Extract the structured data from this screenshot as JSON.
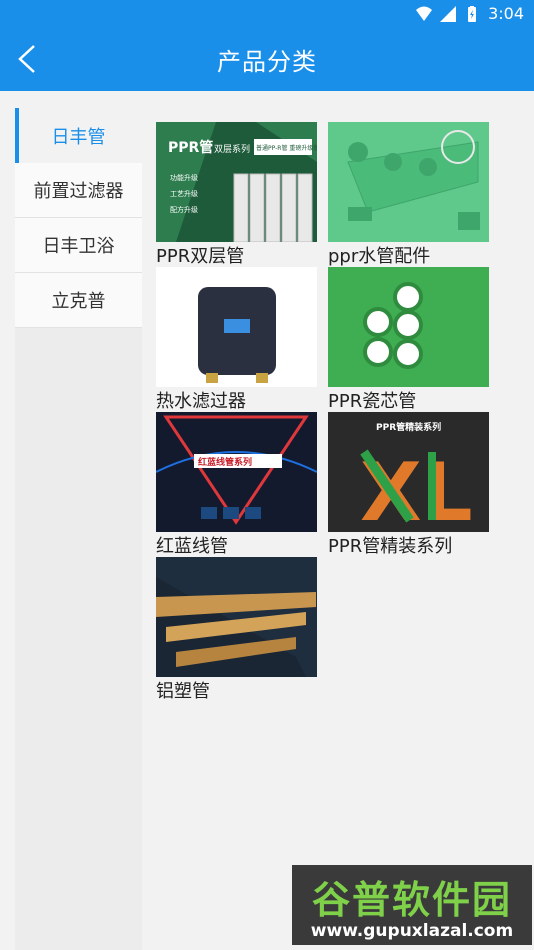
{
  "status": {
    "time": "3:04"
  },
  "header": {
    "title": "产品分类",
    "back_icon": "chevron-left-icon"
  },
  "sidebar": {
    "items": [
      {
        "label": "日丰管",
        "active": true
      },
      {
        "label": "前置过滤器"
      },
      {
        "label": "日丰卫浴"
      },
      {
        "label": "立克普"
      }
    ]
  },
  "products": [
    {
      "name": "PPR双层管",
      "img_title": "PPR管",
      "img_sub": "双层系列",
      "img_badge": "普通PP-R管 重磅升级版",
      "img_lines": [
        "功能升级",
        "工艺升级",
        "配方升级"
      ]
    },
    {
      "name": "ppr水管配件"
    },
    {
      "name": "热水滤过器"
    },
    {
      "name": "PPR瓷芯管"
    },
    {
      "name": "红蓝线管",
      "img_title": "红蓝线管系列"
    },
    {
      "name": "PPR管精装系列",
      "img_title": "PPR管精装系列",
      "img_big": "XL"
    },
    {
      "name": "铝塑管"
    }
  ],
  "watermark": {
    "top": "谷普软件园",
    "bottom": "www.gupuxlazal.com"
  },
  "colors": {
    "accent": "#1a8fea"
  }
}
